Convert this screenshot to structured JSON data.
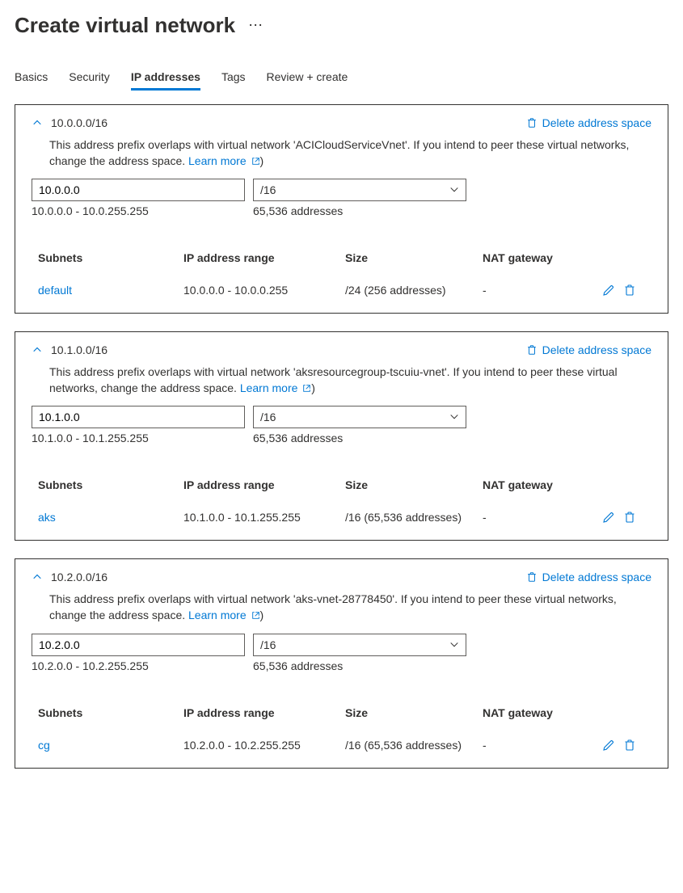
{
  "pageTitle": "Create virtual network",
  "tabs": [
    {
      "label": "Basics",
      "active": false
    },
    {
      "label": "Security",
      "active": false
    },
    {
      "label": "IP addresses",
      "active": true
    },
    {
      "label": "Tags",
      "active": false
    },
    {
      "label": "Review + create",
      "active": false
    }
  ],
  "deleteLabel": "Delete address space",
  "learnMoreLabel": "Learn more",
  "tableHeaders": {
    "subnets": "Subnets",
    "range": "IP address range",
    "size": "Size",
    "nat": "NAT gateway"
  },
  "spaces": [
    {
      "cidr": "10.0.0.0/16",
      "overlap_pre": "This address prefix overlaps with virtual network 'ACICloudServiceVnet'. If you intend to peer these virtual networks, change the address space.",
      "ip_value": "10.0.0.0",
      "prefix_value": "/16",
      "range_text": "10.0.0.0 - 10.0.255.255",
      "count_text": "65,536 addresses",
      "subnets": [
        {
          "name": "default",
          "range": "10.0.0.0 - 10.0.0.255",
          "size": "/24 (256 addresses)",
          "nat": "-"
        }
      ]
    },
    {
      "cidr": "10.1.0.0/16",
      "overlap_pre": "This address prefix overlaps with virtual network 'aksresourcegroup-tscuiu-vnet'. If you intend to peer these virtual networks, change the address space.",
      "ip_value": "10.1.0.0",
      "prefix_value": "/16",
      "range_text": "10.1.0.0 - 10.1.255.255",
      "count_text": "65,536 addresses",
      "subnets": [
        {
          "name": "aks",
          "range": "10.1.0.0 - 10.1.255.255",
          "size": "/16 (65,536 addresses)",
          "nat": "-"
        }
      ]
    },
    {
      "cidr": "10.2.0.0/16",
      "overlap_pre": "This address prefix overlaps with virtual network 'aks-vnet-28778450'. If you intend to peer these virtual networks, change the address space.",
      "ip_value": "10.2.0.0",
      "prefix_value": "/16",
      "range_text": "10.2.0.0 - 10.2.255.255",
      "count_text": "65,536 addresses",
      "subnets": [
        {
          "name": "cg",
          "range": "10.2.0.0 - 10.2.255.255",
          "size": "/16 (65,536 addresses)",
          "nat": "-"
        }
      ]
    }
  ]
}
